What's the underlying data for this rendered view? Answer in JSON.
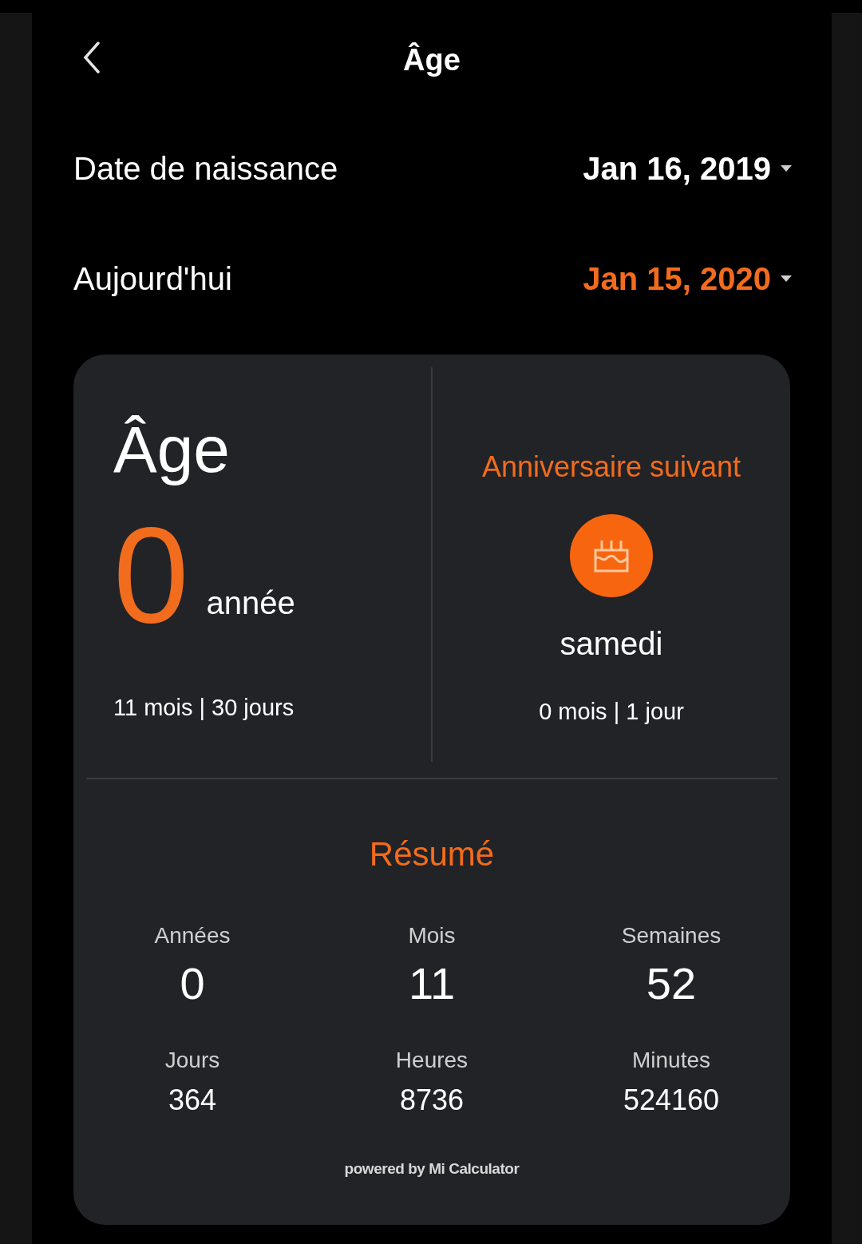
{
  "header": {
    "title": "Âge"
  },
  "dates": [
    {
      "label": "Date de naissance",
      "value": "Jan 16, 2019",
      "accent": false
    },
    {
      "label": "Aujourd'hui",
      "value": "Jan 15, 2020",
      "accent": true
    }
  ],
  "age": {
    "title": "Âge",
    "number": "0",
    "unit": "année",
    "detail": "11 mois | 30 jours"
  },
  "next_birthday": {
    "title": "Anniversaire suivant",
    "weekday": "samedi",
    "detail": "0 mois | 1 jour"
  },
  "summary": {
    "title": "Résumé",
    "stats": [
      {
        "label": "Années",
        "value": "0"
      },
      {
        "label": "Mois",
        "value": "11"
      },
      {
        "label": "Semaines",
        "value": "52"
      },
      {
        "label": "Jours",
        "value": "364"
      },
      {
        "label": "Heures",
        "value": "8736"
      },
      {
        "label": "Minutes",
        "value": "524160"
      }
    ]
  },
  "footer": "powered by Mi Calculator"
}
